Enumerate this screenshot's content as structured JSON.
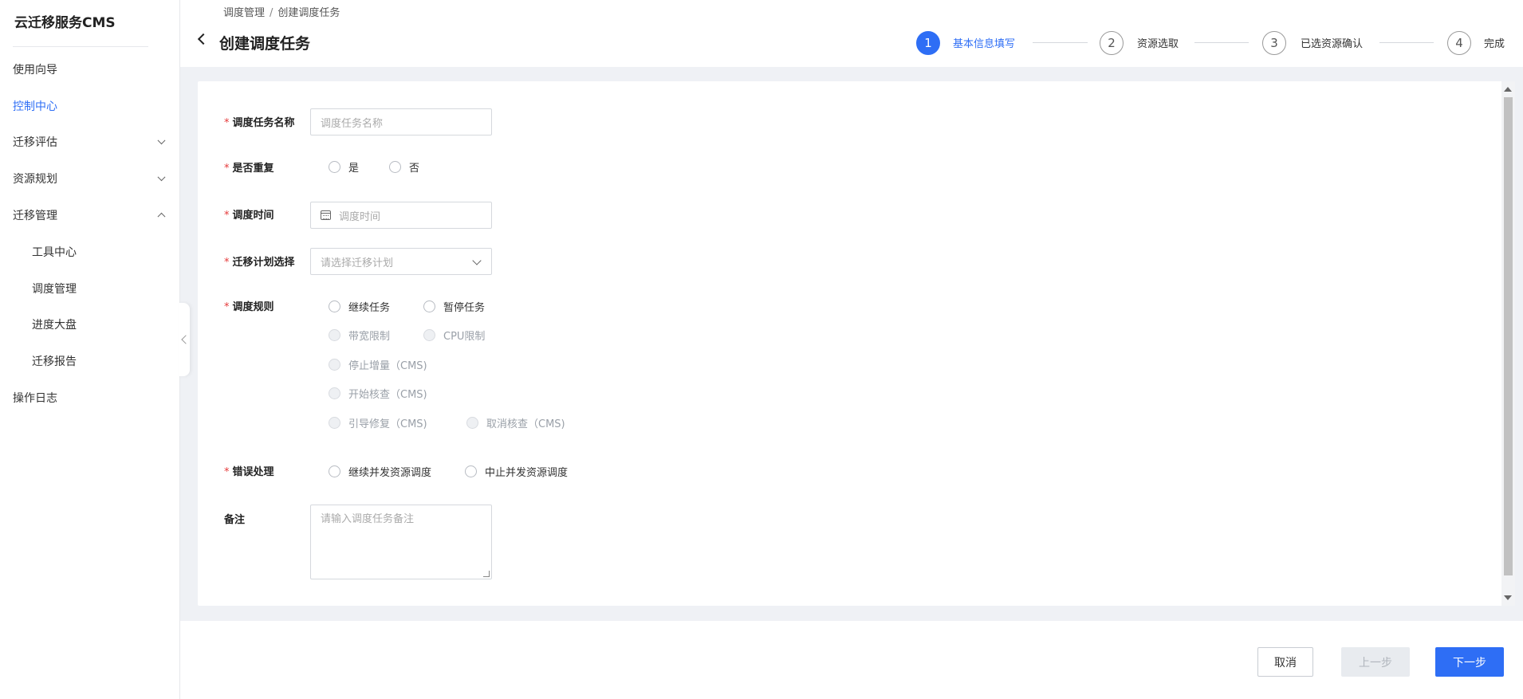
{
  "sidebar": {
    "brand": "云迁移服务CMS",
    "items": [
      {
        "label": "使用向导"
      },
      {
        "label": "控制中心"
      },
      {
        "label": "迁移评估"
      },
      {
        "label": "资源规划"
      },
      {
        "label": "迁移管理"
      },
      {
        "label": "工具中心"
      },
      {
        "label": "调度管理"
      },
      {
        "label": "进度大盘"
      },
      {
        "label": "迁移报告"
      },
      {
        "label": "操作日志"
      }
    ],
    "active_item": "控制中心"
  },
  "header": {
    "breadcrumb": [
      "调度管理",
      "创建调度任务"
    ],
    "breadcrumb_sep": "/",
    "title": "创建调度任务"
  },
  "steps": [
    {
      "num": "1",
      "label": "基本信息填写",
      "active": true
    },
    {
      "num": "2",
      "label": "资源选取",
      "active": false
    },
    {
      "num": "3",
      "label": "已选资源确认",
      "active": false
    },
    {
      "num": "4",
      "label": "完成",
      "active": false
    }
  ],
  "form": {
    "required_mark": "*",
    "task_name": {
      "label": "调度任务名称",
      "placeholder": "调度任务名称"
    },
    "repeat": {
      "label": "是否重复",
      "options": [
        "是",
        "否"
      ]
    },
    "schedule_time": {
      "label": "调度时间",
      "placeholder": "调度时间"
    },
    "plan": {
      "label": "迁移计划选择",
      "placeholder": "请选择迁移计划"
    },
    "rules": {
      "label": "调度规则",
      "options": [
        "继续任务",
        "暂停任务",
        "带宽限制",
        "CPU限制",
        "停止增量（CMS)",
        "开始核查（CMS)",
        "引导修复（CMS)",
        "取消核查（CMS)"
      ]
    },
    "error_handling": {
      "label": "错误处理",
      "options": [
        "继续并发资源调度",
        "中止并发资源调度"
      ]
    },
    "remark": {
      "label": "备注",
      "placeholder": "请输入调度任务备注"
    }
  },
  "footer": {
    "cancel": "取消",
    "prev": "上一步",
    "next": "下一步"
  },
  "colors": {
    "accent": "#2e6ef5",
    "required": "#e5393a",
    "background": "#eff1f5"
  }
}
